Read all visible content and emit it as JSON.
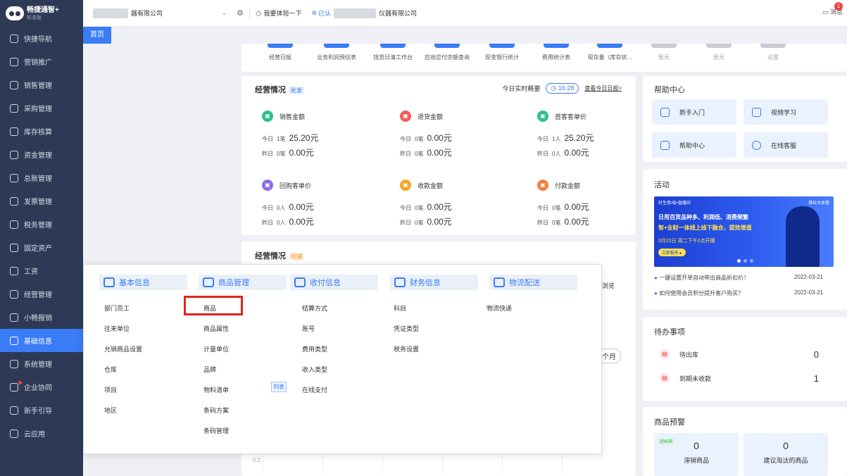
{
  "app": {
    "name": "畅捷通智+",
    "edition": "标准版"
  },
  "sidebar": {
    "items": [
      {
        "label": "快捷导航"
      },
      {
        "label": "营销推广"
      },
      {
        "label": "销售管理"
      },
      {
        "label": "采购管理"
      },
      {
        "label": "库存核算"
      },
      {
        "label": "资金管理"
      },
      {
        "label": "总账管理"
      },
      {
        "label": "发票管理"
      },
      {
        "label": "税务管理"
      },
      {
        "label": "固定资产"
      },
      {
        "label": "工资"
      },
      {
        "label": "经营管理"
      },
      {
        "label": "小畅报销"
      },
      {
        "label": "基础信息"
      },
      {
        "label": "系统管理"
      },
      {
        "label": "企业协同"
      },
      {
        "label": "新手引导"
      },
      {
        "label": "云应用"
      }
    ]
  },
  "topbar": {
    "company": "仪器有限公司",
    "company_short": "器有限公司",
    "try_label": "我要体验一下",
    "cert_label": "已认",
    "cert_company": "仪器有限公司",
    "message": "消息",
    "badge": "1"
  },
  "tabs": {
    "home": "首页"
  },
  "quick": {
    "items": [
      "经营日报",
      "业务利润预估表",
      "钱货日清工作台",
      "应收应付余额查询",
      "现金银行统计",
      "费用统计表",
      "现存量（库存状...",
      "暂无",
      "暂无",
      "设置"
    ]
  },
  "ops": {
    "title": "经营情况",
    "tag": "批发",
    "realtime": "今日实时概要",
    "time": "16:28",
    "link": "查看今日日报>",
    "today": "今日",
    "yesterday": "昨日",
    "stats": [
      {
        "label": "销售金额",
        "today_n": "1笔",
        "today_v": "25.20元",
        "yest_n": "0笔",
        "yest_v": "0.00元"
      },
      {
        "label": "退货金额",
        "today_n": "0笔",
        "today_v": "0.00元",
        "yest_n": "0笔",
        "yest_v": "0.00元"
      },
      {
        "label": "首客客单价",
        "today_n": "1人",
        "today_v": "25.20元",
        "yest_n": "0人",
        "yest_v": "0.00元"
      },
      {
        "label": "回购客单价",
        "today_n": "0人",
        "today_v": "0.00元",
        "yest_n": "0人",
        "yest_v": "0.00元"
      },
      {
        "label": "收款金额",
        "today_n": "0笔",
        "today_v": "0.00元",
        "yest_n": "0笔",
        "yest_v": "0.00元"
      },
      {
        "label": "付款金额",
        "today_n": "0笔",
        "today_v": "0.00元",
        "yest_n": "0笔",
        "yest_v": "0.00元"
      }
    ]
  },
  "ops2": {
    "title": "经营情况",
    "tag": "旺铺",
    "peek": "浏览",
    "month": "个月",
    "axis": "0.2"
  },
  "help": {
    "title": "帮助中心",
    "items": [
      "新手入门",
      "视频学习",
      "帮助中心",
      "在线客服"
    ]
  },
  "activity": {
    "title": "活动",
    "banner_top": "好生意/易•直播间",
    "banner_right": "增长大本营",
    "banner_line1": "日用百货品种多、利润低、消费频繁",
    "banner_line2": "智+业财一体线上线下融合，提效增值",
    "banner_date": "3月22日 周二下午2点开播",
    "banner_btn": "立即报名 ▸",
    "news": [
      {
        "text": "一键设置开单自动带出商品折扣价！",
        "date": "2022-03-21"
      },
      {
        "text": "如何使用会员积分提升客户购买？",
        "date": "2022-03-21"
      }
    ]
  },
  "todo": {
    "title": "待办事项",
    "items": [
      {
        "label": "待出库",
        "count": "0"
      },
      {
        "label": "到期未收款",
        "count": "1"
      }
    ]
  },
  "warning": {
    "title": "商品预警",
    "tag": "近90天",
    "cards": [
      {
        "value": "0",
        "label": "滞销商品"
      },
      {
        "value": "0",
        "label": "建议淘汰的商品"
      }
    ]
  },
  "menu": {
    "columns": [
      {
        "title": "基本信息",
        "items": [
          "部门员工",
          "往来单位",
          "允销商品设置",
          "仓库",
          "项目",
          "地区"
        ]
      },
      {
        "title": "商品管理",
        "items": [
          "商品",
          "商品属性",
          "计量单位",
          "品牌",
          "物料清单",
          "条码方案",
          "条码管理"
        ]
      },
      {
        "title": "收付信息",
        "items": [
          "结算方式",
          "账号",
          "费用类型",
          "收入类型",
          "在线支付"
        ]
      },
      {
        "title": "财务信息",
        "items": [
          "科目",
          "凭证类型",
          "税务设置"
        ]
      },
      {
        "title": "物流配送",
        "items": [
          "物流快递"
        ]
      }
    ],
    "list_tag": "列表"
  }
}
